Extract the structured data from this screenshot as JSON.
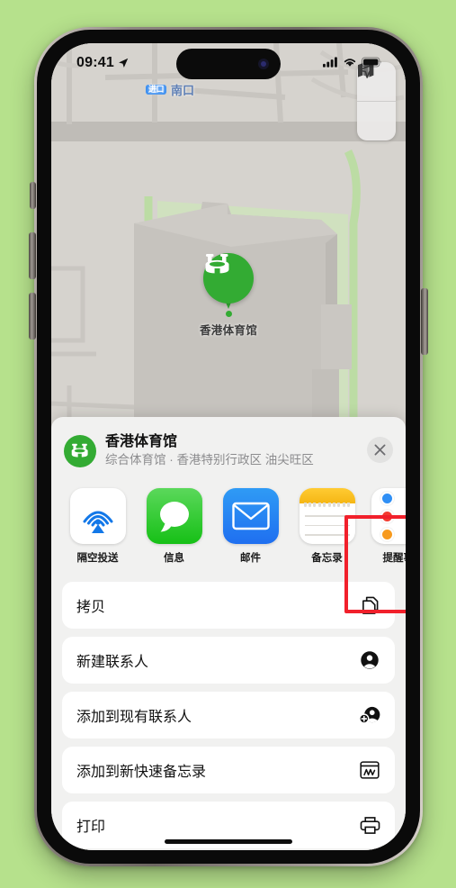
{
  "status_bar": {
    "time": "09:41",
    "location_icon": "location-arrow-icon",
    "cellular_icon": "cellular-bars-icon",
    "wifi_icon": "wifi-icon",
    "battery_icon": "battery-full-icon"
  },
  "map": {
    "poi_label": "香港体育馆",
    "street_label": "南口",
    "street_badge": "进口",
    "controls": [
      {
        "name": "map-layers-button",
        "icon": "map-icon"
      },
      {
        "name": "locate-me-button",
        "icon": "navigation-arrow-icon"
      }
    ],
    "pin_icon": "stadium-icon",
    "pin_color": "#33ab33"
  },
  "share_sheet": {
    "title": "香港体育馆",
    "subtitle": "综合体育馆 · 香港特别行政区 油尖旺区",
    "avatar_icon": "stadium-icon",
    "close_icon": "close-x-icon",
    "apps": [
      {
        "label": "隔空投送",
        "icon": "airdrop-icon",
        "highlighted": false
      },
      {
        "label": "信息",
        "icon": "messages-icon",
        "highlighted": false
      },
      {
        "label": "邮件",
        "icon": "mail-icon",
        "highlighted": false
      },
      {
        "label": "备忘录",
        "icon": "notes-icon",
        "highlighted": true
      },
      {
        "label": "提醒事项",
        "icon": "reminders-icon",
        "highlighted": false
      }
    ],
    "actions": [
      {
        "label": "拷贝",
        "icon": "copy-icon"
      },
      {
        "label": "新建联系人",
        "icon": "person-circle-icon"
      },
      {
        "label": "添加到现有联系人",
        "icon": "person-add-icon"
      },
      {
        "label": "添加到新快速备忘录",
        "icon": "quick-note-icon"
      },
      {
        "label": "打印",
        "icon": "printer-icon"
      }
    ],
    "highlight_color": "#f1202b"
  }
}
